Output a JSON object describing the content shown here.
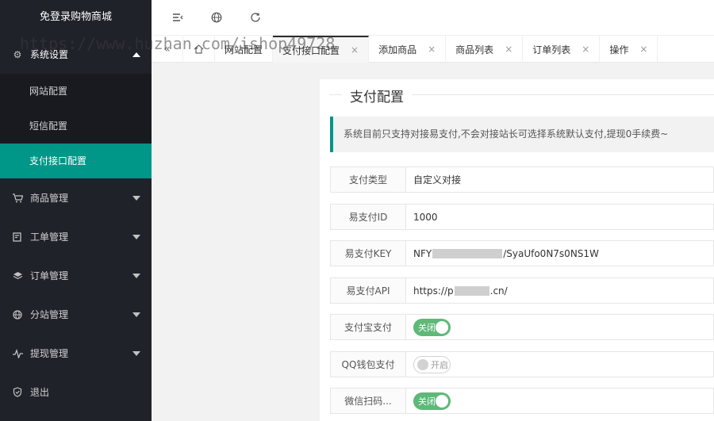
{
  "app": {
    "title": "免登录购物商城"
  },
  "sidebar": {
    "items": [
      {
        "label": "系统设置",
        "icon": "gear-icon",
        "open": true,
        "children": [
          {
            "label": "网站配置"
          },
          {
            "label": "短信配置"
          },
          {
            "label": "支付接口配置",
            "active": true
          }
        ]
      },
      {
        "label": "商品管理",
        "icon": "cart-icon"
      },
      {
        "label": "工单管理",
        "icon": "ticket-icon"
      },
      {
        "label": "订单管理",
        "icon": "layers-icon"
      },
      {
        "label": "分站管理",
        "icon": "globe-icon"
      },
      {
        "label": "提现管理",
        "icon": "pulse-icon"
      },
      {
        "label": "退出",
        "icon": "shield-icon"
      }
    ]
  },
  "header": {
    "icons": [
      "menu-fold-icon",
      "globe-icon",
      "refresh-icon"
    ]
  },
  "tabs": {
    "items": [
      {
        "label": "网站配置"
      },
      {
        "label": "支付接口配置",
        "active": true
      },
      {
        "label": "添加商品"
      },
      {
        "label": "商品列表"
      },
      {
        "label": "订单列表"
      },
      {
        "label": "操作"
      }
    ],
    "close_glyph": "×"
  },
  "watermark": "https://www.huzhan.com/ishop49728",
  "main": {
    "title": "支付配置",
    "notice": "系统目前只支持对接易支付,不会对接站长可选择系统默认支付,提现0手续费~",
    "fields": [
      {
        "label": "支付类型",
        "value": "自定义对接"
      },
      {
        "label": "易支付ID",
        "value": "1000"
      },
      {
        "label": "易支付KEY",
        "value_prefix": "NFY",
        "value_suffix": "/SyaUfo0N7s0NS1W"
      },
      {
        "label": "易支付API",
        "value_prefix": "https://p",
        "value_suffix": ".cn/"
      },
      {
        "label": "支付宝支付",
        "switch_text": "关闭",
        "switch_state": "on"
      },
      {
        "label": "QQ钱包支付",
        "switch_text": "开启",
        "switch_state": "off"
      },
      {
        "label": "微信扫码...",
        "switch_text": "关闭",
        "switch_state": "on"
      }
    ]
  },
  "colors": {
    "sidebar_bg": "#20222a",
    "accent": "#009688",
    "switch_on": "#5fb878"
  }
}
